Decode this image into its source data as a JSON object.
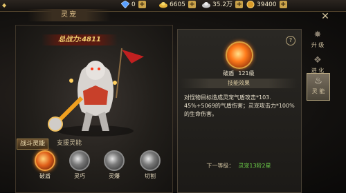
{
  "window": {
    "title": "灵宠"
  },
  "resources": [
    {
      "icon": "diamond-icon",
      "value": "0"
    },
    {
      "icon": "gold-ingot-icon",
      "value": "6605"
    },
    {
      "icon": "silver-ingot-icon",
      "value": "35.2万"
    },
    {
      "icon": "coin-icon",
      "value": "39400"
    }
  ],
  "pet": {
    "power_label": "总战力:4811"
  },
  "tabs": [
    {
      "label": "战斗灵能",
      "active": true
    },
    {
      "label": "支援灵能",
      "active": false
    }
  ],
  "skills": [
    {
      "label": "破盾",
      "selected": true
    },
    {
      "label": "灵巧",
      "selected": false
    },
    {
      "label": "灵爆",
      "selected": false
    },
    {
      "label": "切割",
      "selected": false
    }
  ],
  "detail": {
    "name": "破盾",
    "level": "121级",
    "effect_header": "技能效果",
    "description": "对怪物目标造成灵宠气盾攻击*103. 45%+5069的气盾伤害；灵宠攻击力*100%的生命伤害。",
    "next_label": "下一等级：",
    "next_value": "灵宠13阶2星"
  },
  "side_tabs": [
    {
      "label": "升 级",
      "icon": "wolf-icon",
      "active": false
    },
    {
      "label": "进 化",
      "icon": "beast-icon",
      "active": false
    },
    {
      "label": "灵 能",
      "icon": "spirit-icon",
      "active": true
    }
  ]
}
